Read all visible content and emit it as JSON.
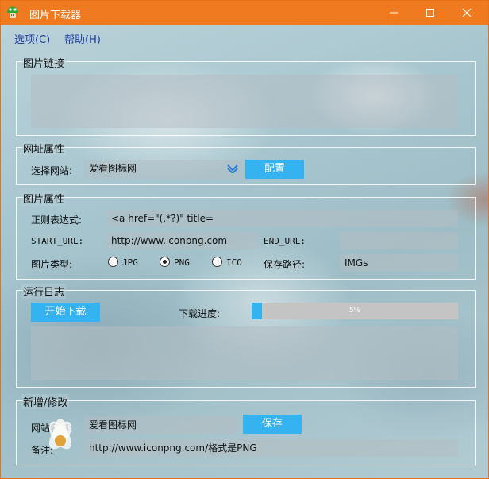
{
  "window": {
    "title": "图片下载器",
    "accent_color": "#f07a1f"
  },
  "menu": [
    {
      "label": "选项(C)"
    },
    {
      "label": "帮助(H)"
    }
  ],
  "links_group": {
    "legend": "图片链接",
    "text": ""
  },
  "site_group": {
    "legend": "网址属性",
    "select_label": "选择网站:",
    "selected_site": "爱看图标网",
    "config_button": "配置"
  },
  "image_group": {
    "legend": "图片属性",
    "regex_label": "正则表达式:",
    "regex_value": "<a href=\"(.*?)\" title=",
    "start_url_label": "START_URL:",
    "start_url_value": "http://www.iconpng.com",
    "end_url_label": "END_URL:",
    "end_url_value": "",
    "type_label": "图片类型:",
    "types": [
      {
        "label": "JPG",
        "checked": false
      },
      {
        "label": "PNG",
        "checked": true
      },
      {
        "label": "ICO",
        "checked": false
      }
    ],
    "save_path_label": "保存路径:",
    "save_path_value": "IMGs"
  },
  "log_group": {
    "legend": "运行日志",
    "start_button": "开始下载",
    "progress_label": "下载进度:",
    "progress_text": "5%",
    "progress_fraction": 0.05,
    "log_text": ""
  },
  "edit_group": {
    "legend": "新增/修改",
    "site_name_label": "网站名称:",
    "site_name_value": "爱看图标网",
    "save_button": "保存",
    "note_label": "备注:",
    "note_value": "http://www.iconpng.com/格式是PNG"
  },
  "colors": {
    "button": "#35b2f0",
    "progress_fill": "#35b2f0",
    "field": "#b4bec3"
  }
}
